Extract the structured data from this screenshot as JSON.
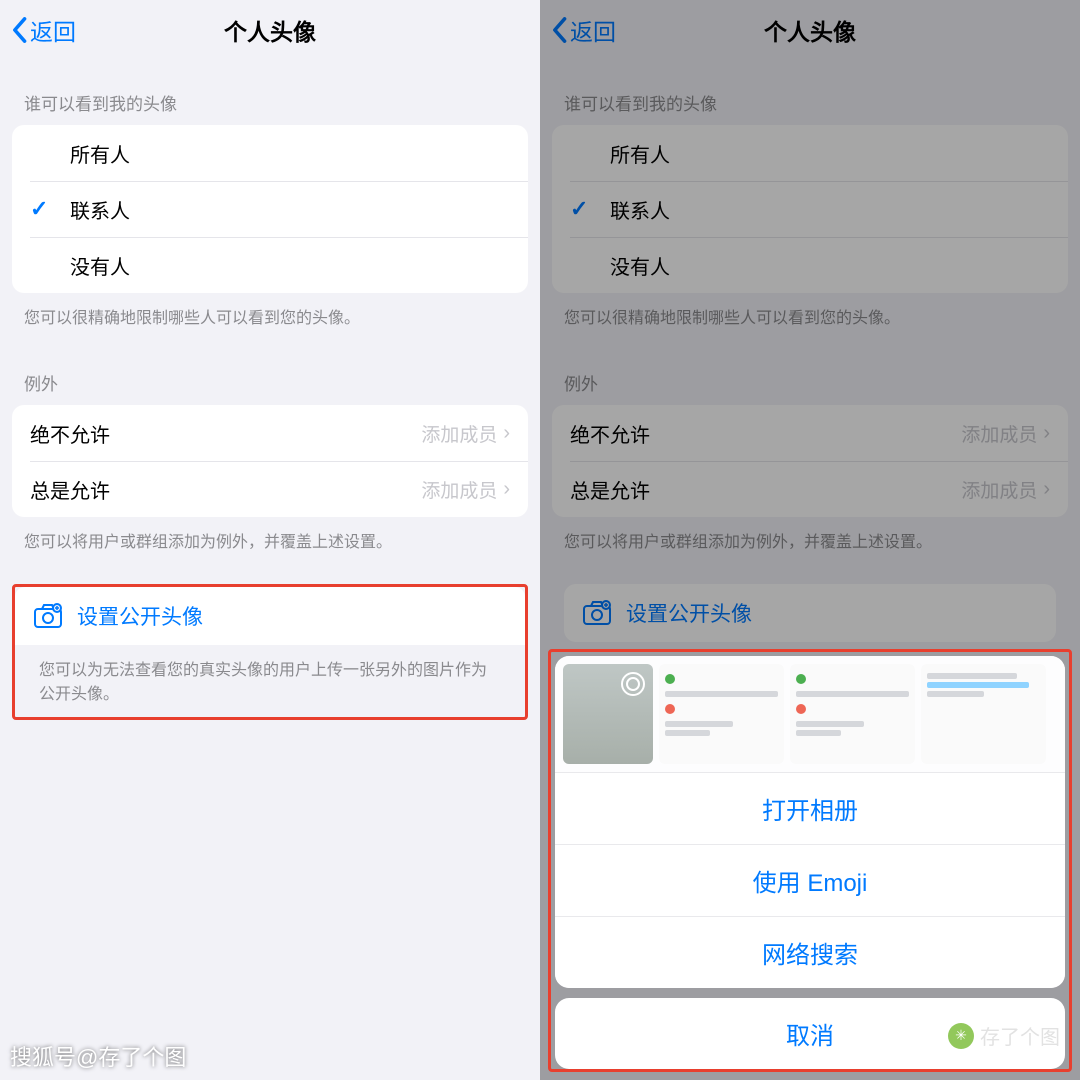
{
  "nav": {
    "back": "返回",
    "title": "个人头像"
  },
  "section1": {
    "header": "谁可以看到我的头像",
    "options": [
      "所有人",
      "联系人",
      "没有人"
    ],
    "selectedIndex": 1,
    "footer": "您可以很精确地限制哪些人可以看到您的头像。"
  },
  "section2": {
    "header": "例外",
    "rows": [
      {
        "label": "绝不允许",
        "value": "添加成员"
      },
      {
        "label": "总是允许",
        "value": "添加成员"
      }
    ],
    "footer": "您可以将用户或群组添加为例外，并覆盖上述设置。"
  },
  "section3": {
    "action": "设置公开头像",
    "footer": "您可以为无法查看您的真实头像的用户上传一张另外的图片作为公开头像。"
  },
  "sheet": {
    "options": [
      "打开相册",
      "使用 Emoji",
      "网络搜索"
    ],
    "cancel": "取消"
  },
  "watermark": {
    "left": "搜狐号@存了个图",
    "right": "存了个图"
  },
  "colors": {
    "accent": "#007aff",
    "highlight": "#e83f2e"
  }
}
